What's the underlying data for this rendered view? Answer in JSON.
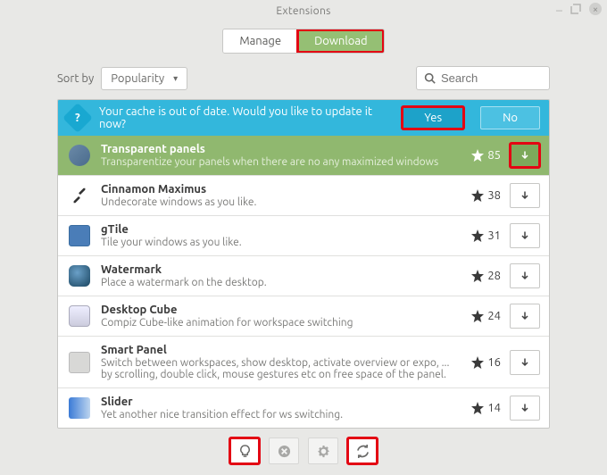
{
  "window": {
    "title": "Extensions"
  },
  "tabs": {
    "manage": "Manage",
    "download": "Download"
  },
  "sort": {
    "label": "Sort by",
    "value": "Popularity"
  },
  "search": {
    "placeholder": "Search"
  },
  "banner": {
    "text": "Your cache is out of date. Would you like to update it now?",
    "yes": "Yes",
    "no": "No"
  },
  "extensions": [
    {
      "name": "Transparent panels",
      "desc": "Transparentize your panels when there are no any maximized windows",
      "rating": "85"
    },
    {
      "name": "Cinnamon Maximus",
      "desc": "Undecorate windows as you like.",
      "rating": "38"
    },
    {
      "name": "gTile",
      "desc": "Tile your windows as you like.",
      "rating": "31"
    },
    {
      "name": "Watermark",
      "desc": "Place a watermark on the desktop.",
      "rating": "28"
    },
    {
      "name": "Desktop Cube",
      "desc": "Compiz Cube-like animation for workspace switching",
      "rating": "24"
    },
    {
      "name": "Smart Panel",
      "desc": "Switch between workspaces, show desktop, activate overview or expo, ... by scrolling, double click, mouse gestures etc on free space of the panel.",
      "rating": "16"
    },
    {
      "name": "Slider",
      "desc": "Yet another nice transition effect for ws switching.",
      "rating": "14"
    }
  ]
}
